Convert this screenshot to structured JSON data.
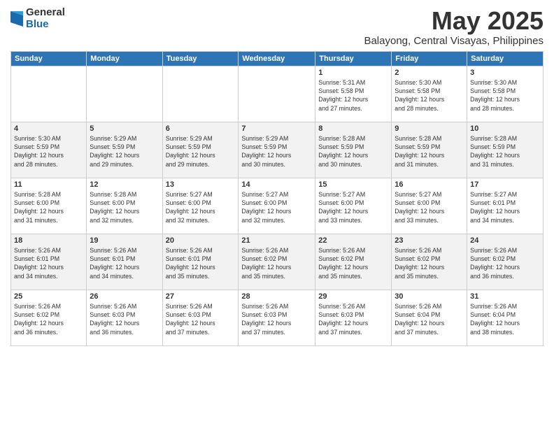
{
  "logo": {
    "general": "General",
    "blue": "Blue"
  },
  "title": "May 2025",
  "subtitle": "Balayong, Central Visayas, Philippines",
  "days_header": [
    "Sunday",
    "Monday",
    "Tuesday",
    "Wednesday",
    "Thursday",
    "Friday",
    "Saturday"
  ],
  "weeks": [
    [
      {
        "day": "",
        "info": ""
      },
      {
        "day": "",
        "info": ""
      },
      {
        "day": "",
        "info": ""
      },
      {
        "day": "",
        "info": ""
      },
      {
        "day": "1",
        "info": "Sunrise: 5:31 AM\nSunset: 5:58 PM\nDaylight: 12 hours\nand 27 minutes."
      },
      {
        "day": "2",
        "info": "Sunrise: 5:30 AM\nSunset: 5:58 PM\nDaylight: 12 hours\nand 28 minutes."
      },
      {
        "day": "3",
        "info": "Sunrise: 5:30 AM\nSunset: 5:58 PM\nDaylight: 12 hours\nand 28 minutes."
      }
    ],
    [
      {
        "day": "4",
        "info": "Sunrise: 5:30 AM\nSunset: 5:59 PM\nDaylight: 12 hours\nand 28 minutes."
      },
      {
        "day": "5",
        "info": "Sunrise: 5:29 AM\nSunset: 5:59 PM\nDaylight: 12 hours\nand 29 minutes."
      },
      {
        "day": "6",
        "info": "Sunrise: 5:29 AM\nSunset: 5:59 PM\nDaylight: 12 hours\nand 29 minutes."
      },
      {
        "day": "7",
        "info": "Sunrise: 5:29 AM\nSunset: 5:59 PM\nDaylight: 12 hours\nand 30 minutes."
      },
      {
        "day": "8",
        "info": "Sunrise: 5:28 AM\nSunset: 5:59 PM\nDaylight: 12 hours\nand 30 minutes."
      },
      {
        "day": "9",
        "info": "Sunrise: 5:28 AM\nSunset: 5:59 PM\nDaylight: 12 hours\nand 31 minutes."
      },
      {
        "day": "10",
        "info": "Sunrise: 5:28 AM\nSunset: 5:59 PM\nDaylight: 12 hours\nand 31 minutes."
      }
    ],
    [
      {
        "day": "11",
        "info": "Sunrise: 5:28 AM\nSunset: 6:00 PM\nDaylight: 12 hours\nand 31 minutes."
      },
      {
        "day": "12",
        "info": "Sunrise: 5:28 AM\nSunset: 6:00 PM\nDaylight: 12 hours\nand 32 minutes."
      },
      {
        "day": "13",
        "info": "Sunrise: 5:27 AM\nSunset: 6:00 PM\nDaylight: 12 hours\nand 32 minutes."
      },
      {
        "day": "14",
        "info": "Sunrise: 5:27 AM\nSunset: 6:00 PM\nDaylight: 12 hours\nand 32 minutes."
      },
      {
        "day": "15",
        "info": "Sunrise: 5:27 AM\nSunset: 6:00 PM\nDaylight: 12 hours\nand 33 minutes."
      },
      {
        "day": "16",
        "info": "Sunrise: 5:27 AM\nSunset: 6:00 PM\nDaylight: 12 hours\nand 33 minutes."
      },
      {
        "day": "17",
        "info": "Sunrise: 5:27 AM\nSunset: 6:01 PM\nDaylight: 12 hours\nand 34 minutes."
      }
    ],
    [
      {
        "day": "18",
        "info": "Sunrise: 5:26 AM\nSunset: 6:01 PM\nDaylight: 12 hours\nand 34 minutes."
      },
      {
        "day": "19",
        "info": "Sunrise: 5:26 AM\nSunset: 6:01 PM\nDaylight: 12 hours\nand 34 minutes."
      },
      {
        "day": "20",
        "info": "Sunrise: 5:26 AM\nSunset: 6:01 PM\nDaylight: 12 hours\nand 35 minutes."
      },
      {
        "day": "21",
        "info": "Sunrise: 5:26 AM\nSunset: 6:02 PM\nDaylight: 12 hours\nand 35 minutes."
      },
      {
        "day": "22",
        "info": "Sunrise: 5:26 AM\nSunset: 6:02 PM\nDaylight: 12 hours\nand 35 minutes."
      },
      {
        "day": "23",
        "info": "Sunrise: 5:26 AM\nSunset: 6:02 PM\nDaylight: 12 hours\nand 35 minutes."
      },
      {
        "day": "24",
        "info": "Sunrise: 5:26 AM\nSunset: 6:02 PM\nDaylight: 12 hours\nand 36 minutes."
      }
    ],
    [
      {
        "day": "25",
        "info": "Sunrise: 5:26 AM\nSunset: 6:02 PM\nDaylight: 12 hours\nand 36 minutes."
      },
      {
        "day": "26",
        "info": "Sunrise: 5:26 AM\nSunset: 6:03 PM\nDaylight: 12 hours\nand 36 minutes."
      },
      {
        "day": "27",
        "info": "Sunrise: 5:26 AM\nSunset: 6:03 PM\nDaylight: 12 hours\nand 37 minutes."
      },
      {
        "day": "28",
        "info": "Sunrise: 5:26 AM\nSunset: 6:03 PM\nDaylight: 12 hours\nand 37 minutes."
      },
      {
        "day": "29",
        "info": "Sunrise: 5:26 AM\nSunset: 6:03 PM\nDaylight: 12 hours\nand 37 minutes."
      },
      {
        "day": "30",
        "info": "Sunrise: 5:26 AM\nSunset: 6:04 PM\nDaylight: 12 hours\nand 37 minutes."
      },
      {
        "day": "31",
        "info": "Sunrise: 5:26 AM\nSunset: 6:04 PM\nDaylight: 12 hours\nand 38 minutes."
      }
    ]
  ]
}
